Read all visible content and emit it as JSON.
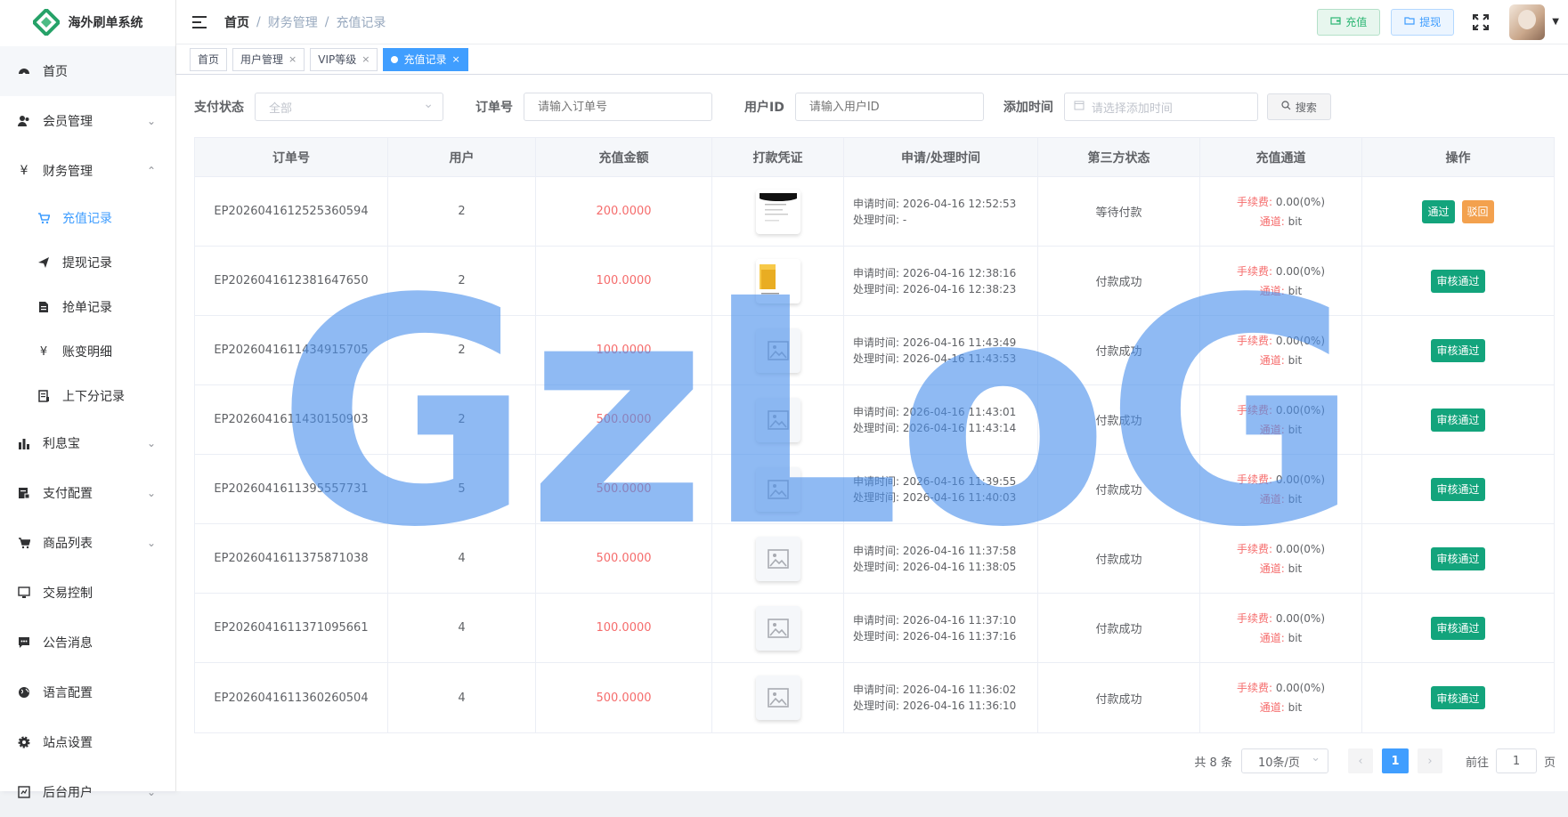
{
  "app": {
    "name": "海外刷单系统"
  },
  "sidebar": {
    "items": [
      {
        "label": "首页",
        "icon": "dashboard-icon"
      },
      {
        "label": "会员管理",
        "icon": "user-icon"
      },
      {
        "label": "财务管理",
        "icon": "yen-icon"
      },
      {
        "label": "利息宝",
        "icon": "bar-chart-icon"
      },
      {
        "label": "支付配置",
        "icon": "payment-icon"
      },
      {
        "label": "商品列表",
        "icon": "cart-icon"
      },
      {
        "label": "交易控制",
        "icon": "monitor-icon"
      },
      {
        "label": "公告消息",
        "icon": "message-icon"
      },
      {
        "label": "语言配置",
        "icon": "globe-icon"
      },
      {
        "label": "站点设置",
        "icon": "gear-icon"
      },
      {
        "label": "后台用户",
        "icon": "user-admin-icon"
      }
    ],
    "finance_sub": [
      {
        "label": "充值记录",
        "icon": "cart-icon"
      },
      {
        "label": "提现记录",
        "icon": "send-icon"
      },
      {
        "label": "抢单记录",
        "icon": "document-icon"
      },
      {
        "label": "账变明细",
        "icon": "yen-icon"
      },
      {
        "label": "上下分记录",
        "icon": "list-icon"
      }
    ]
  },
  "header": {
    "breadcrumb": [
      "首页",
      "财务管理",
      "充值记录"
    ],
    "recharge_label": "充值",
    "withdraw_label": "提现"
  },
  "tags": [
    {
      "label": "首页"
    },
    {
      "label": "用户管理"
    },
    {
      "label": "VIP等级"
    },
    {
      "label": "充值记录"
    }
  ],
  "filters": {
    "pay_status_label": "支付状态",
    "pay_status_value": "全部",
    "order_label": "订单号",
    "order_placeholder": "请输入订单号",
    "user_label": "用户ID",
    "user_placeholder": "请输入用户ID",
    "time_label": "添加时间",
    "time_placeholder": "请选择添加时间",
    "search_label": "搜索"
  },
  "table": {
    "columns": [
      "订单号",
      "用户",
      "充值金额",
      "打款凭证",
      "申请/处理时间",
      "第三方状态",
      "充值通道",
      "操作"
    ],
    "apply_prefix": "申请时间: ",
    "process_prefix": "处理时间: ",
    "fee_label": "手续费:",
    "channel_label": "通道:",
    "pass_label": "通过",
    "reject_label": "驳回",
    "approved_label": "审核通过",
    "rows": [
      {
        "order": "EP2026041612525360594",
        "user": "2",
        "amount": "200.0000",
        "voucher": "doc",
        "apply": "申请时间: 2026-04-16 12:52:53",
        "process": "处理时间: -",
        "status": "等待付款",
        "fee": "0.00(0%)",
        "channel": "bit",
        "pending": true
      },
      {
        "order": "EP2026041612381647650",
        "user": "2",
        "amount": "100.0000",
        "voucher": "folder",
        "apply": "申请时间: 2026-04-16 12:38:16",
        "process": "处理时间: 2026-04-16 12:38:23",
        "status": "付款成功",
        "fee": "0.00(0%)",
        "channel": "bit",
        "pending": false
      },
      {
        "order": "EP2026041611434915705",
        "user": "2",
        "amount": "100.0000",
        "voucher": "none",
        "apply": "申请时间: 2026-04-16 11:43:49",
        "process": "处理时间: 2026-04-16 11:43:53",
        "status": "付款成功",
        "fee": "0.00(0%)",
        "channel": "bit",
        "pending": false
      },
      {
        "order": "EP2026041611430150903",
        "user": "2",
        "amount": "500.0000",
        "voucher": "none",
        "apply": "申请时间: 2026-04-16 11:43:01",
        "process": "处理时间: 2026-04-16 11:43:14",
        "status": "付款成功",
        "fee": "0.00(0%)",
        "channel": "bit",
        "pending": false
      },
      {
        "order": "EP2026041611395557731",
        "user": "5",
        "amount": "500.0000",
        "voucher": "none",
        "apply": "申请时间: 2026-04-16 11:39:55",
        "process": "处理时间: 2026-04-16 11:40:03",
        "status": "付款成功",
        "fee": "0.00(0%)",
        "channel": "bit",
        "pending": false
      },
      {
        "order": "EP2026041611375871038",
        "user": "4",
        "amount": "500.0000",
        "voucher": "none",
        "apply": "申请时间: 2026-04-16 11:37:58",
        "process": "处理时间: 2026-04-16 11:38:05",
        "status": "付款成功",
        "fee": "0.00(0%)",
        "channel": "bit",
        "pending": false
      },
      {
        "order": "EP2026041611371095661",
        "user": "4",
        "amount": "100.0000",
        "voucher": "none",
        "apply": "申请时间: 2026-04-16 11:37:10",
        "process": "处理时间: 2026-04-16 11:37:16",
        "status": "付款成功",
        "fee": "0.00(0%)",
        "channel": "bit",
        "pending": false
      },
      {
        "order": "EP2026041611360260504",
        "user": "4",
        "amount": "500.0000",
        "voucher": "none",
        "apply": "申请时间: 2026-04-16 11:36:02",
        "process": "处理时间: 2026-04-16 11:36:10",
        "status": "付款成功",
        "fee": "0.00(0%)",
        "channel": "bit",
        "pending": false
      }
    ]
  },
  "pagination": {
    "total": "共 8 条",
    "page_size": "10条/页",
    "current": "1",
    "goto_prefix": "前往",
    "goto_value": "1",
    "goto_suffix": "页"
  },
  "watermark": {
    "text": "GzLoG"
  },
  "colors": {
    "accent": "#409eff",
    "success": "#13a47c",
    "warning": "#f3a14e",
    "danger": "#f56c6c"
  }
}
